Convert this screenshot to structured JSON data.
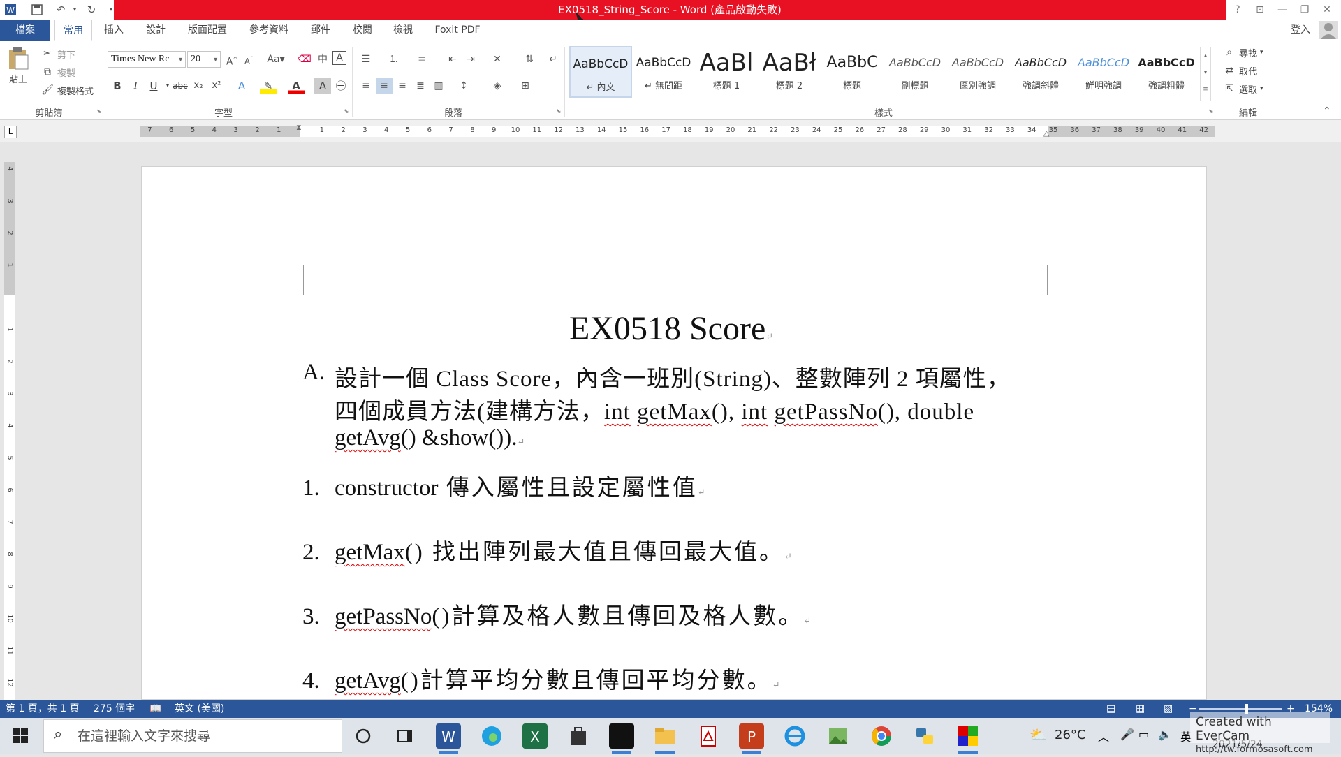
{
  "window": {
    "title": "EX0518_String_Score - Word (產品啟動失敗)",
    "help": "?",
    "minimize": "—",
    "restore": "❐",
    "close": "✕"
  },
  "tabs": [
    "檔案",
    "常用",
    "插入",
    "設計",
    "版面配置",
    "參考資料",
    "郵件",
    "校閱",
    "檢視",
    "Foxit PDF"
  ],
  "signin": "登入",
  "clipboard": {
    "paste": "貼上",
    "cut": "剪下",
    "copy": "複製",
    "format_painter": "複製格式",
    "group": "剪貼簿"
  },
  "font": {
    "name": "Times New Rc",
    "size": "20",
    "group": "字型"
  },
  "paragraph": {
    "group": "段落"
  },
  "styles": {
    "group": "樣式",
    "items": [
      {
        "preview": "AaBbCcD",
        "name": "↵ 內文"
      },
      {
        "preview": "AaBbCcD",
        "name": "↵ 無間距"
      },
      {
        "preview": "AaBl",
        "name": "標題 1"
      },
      {
        "preview": "AaBł",
        "name": "標題 2"
      },
      {
        "preview": "AaBbC",
        "name": "標題"
      },
      {
        "preview": "AaBbCcD",
        "name": "副標題"
      },
      {
        "preview": "AaBbCcD",
        "name": "區別強調"
      },
      {
        "preview": "AaBbCcD",
        "name": "強調斜體"
      },
      {
        "preview": "AaBbCcD",
        "name": "鮮明強調"
      },
      {
        "preview": "AaBbCcD",
        "name": "強調粗體"
      }
    ]
  },
  "editing": {
    "find": "尋找",
    "replace": "取代",
    "select": "選取",
    "group": "編輯"
  },
  "ruler": {
    "tab_selector": "L",
    "left_numbers": [
      "7",
      "6",
      "5",
      "4",
      "3",
      "2",
      "1"
    ],
    "right_numbers": [
      "1",
      "2",
      "3",
      "4",
      "5",
      "6",
      "7",
      "8",
      "9",
      "10",
      "11",
      "12",
      "13",
      "14",
      "15",
      "16",
      "17",
      "18",
      "19",
      "20",
      "21",
      "22",
      "23",
      "24",
      "25",
      "26",
      "27",
      "28",
      "29",
      "30",
      "31",
      "32",
      "33",
      "34",
      "35",
      "36",
      "37",
      "38",
      "39",
      "40",
      "41",
      "42"
    ],
    "vertical_numbers": [
      "4",
      "3",
      "2",
      "1",
      "",
      "1",
      "2",
      "3",
      "4",
      "5",
      "6",
      "7",
      "8",
      "9",
      "10",
      "11",
      "12"
    ]
  },
  "document": {
    "title": "EX0518 Score",
    "a_label": "A.",
    "a_line1": "設計一個 Class Score，內含一班別(String)、整數陣列 2 項屬性，",
    "a_line2_pre": "四個成員方法(建構方法，",
    "a_line2_int1": "int",
    "a_line2_getmax": "getMax",
    "a_line2_mid": "(), ",
    "a_line2_int2": "int",
    "a_line2_getpass": "getPassNo",
    "a_line2_post": "(), double",
    "a_line3_getavg": "getAvg",
    "a_line3_post": "() &show()).",
    "items": [
      {
        "num": "1.",
        "code": "constructor",
        "text": "  傳入屬性且設定屬性值",
        "wavy": false
      },
      {
        "num": "2.",
        "code": "getMax",
        "text": "()  找出陣列最大值且傳回最大值。",
        "wavy": true
      },
      {
        "num": "3.",
        "code": "getPassNo",
        "text": "()計算及格人數且傳回及格人數。",
        "wavy": true
      },
      {
        "num": "4.",
        "code": "getAvg",
        "text": "()計算平均分數且傳回平均分數。",
        "wavy": true
      }
    ]
  },
  "status": {
    "page": "第 1 頁，共 1 頁",
    "words": "275 個字",
    "lang": "英文 (美國)",
    "zoom": "154%"
  },
  "taskbar": {
    "search_placeholder": "在這裡輸入文字來搜尋",
    "temperature": "26°C",
    "ime": "英",
    "date": "2021/5/24"
  },
  "watermark": {
    "line1": "Created with EverCam",
    "line2": "http://tw.formosasoft.com"
  },
  "colors": {
    "word_blue": "#2b579a",
    "title_red": "#e81123",
    "spell_red": "#dd0000"
  }
}
